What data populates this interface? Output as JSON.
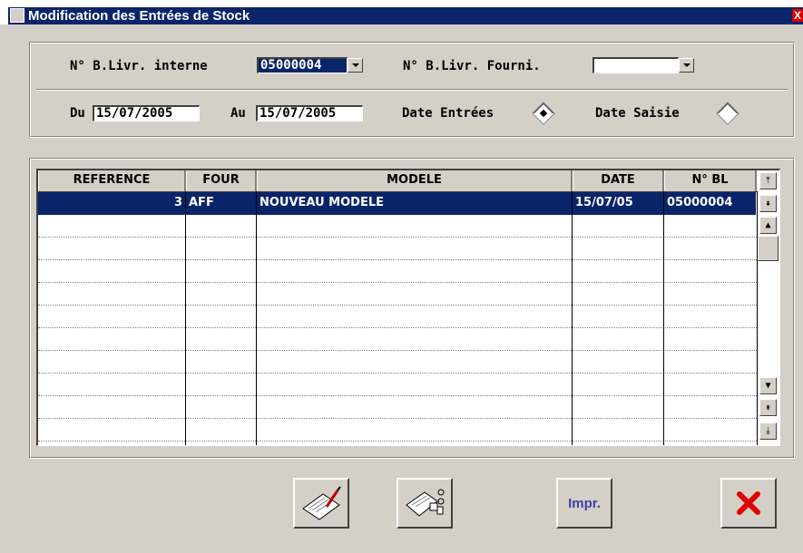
{
  "window": {
    "title": "Modification des Entrées de Stock",
    "close_label": "X"
  },
  "filters": {
    "bl_interne_label": "N° B.Livr. interne",
    "bl_interne_value": "05000004",
    "bl_fournisseur_label": "N° B.Livr. Fourni.",
    "bl_fournisseur_value": "",
    "du_label": "Du",
    "du_value": "15/07/2005",
    "au_label": "Au",
    "au_value": "15/07/2005",
    "date_entrees_label": "Date Entrées",
    "date_entrees_checked": true,
    "date_saisie_label": "Date Saisie",
    "date_saisie_checked": false
  },
  "table": {
    "columns": [
      "REFERENCE",
      "FOUR",
      "MODELE",
      "DATE",
      "N° BL"
    ],
    "rows": [
      {
        "reference": "3",
        "four": "AFF",
        "modele": "NOUVEAU MODELE",
        "date": "15/07/05",
        "bl": "05000004"
      }
    ]
  },
  "buttons": {
    "edit_icon": "pen-document-icon",
    "query_icon": "document-search-icon",
    "print_label": "Impr.",
    "cancel_icon": "red-x-icon"
  }
}
